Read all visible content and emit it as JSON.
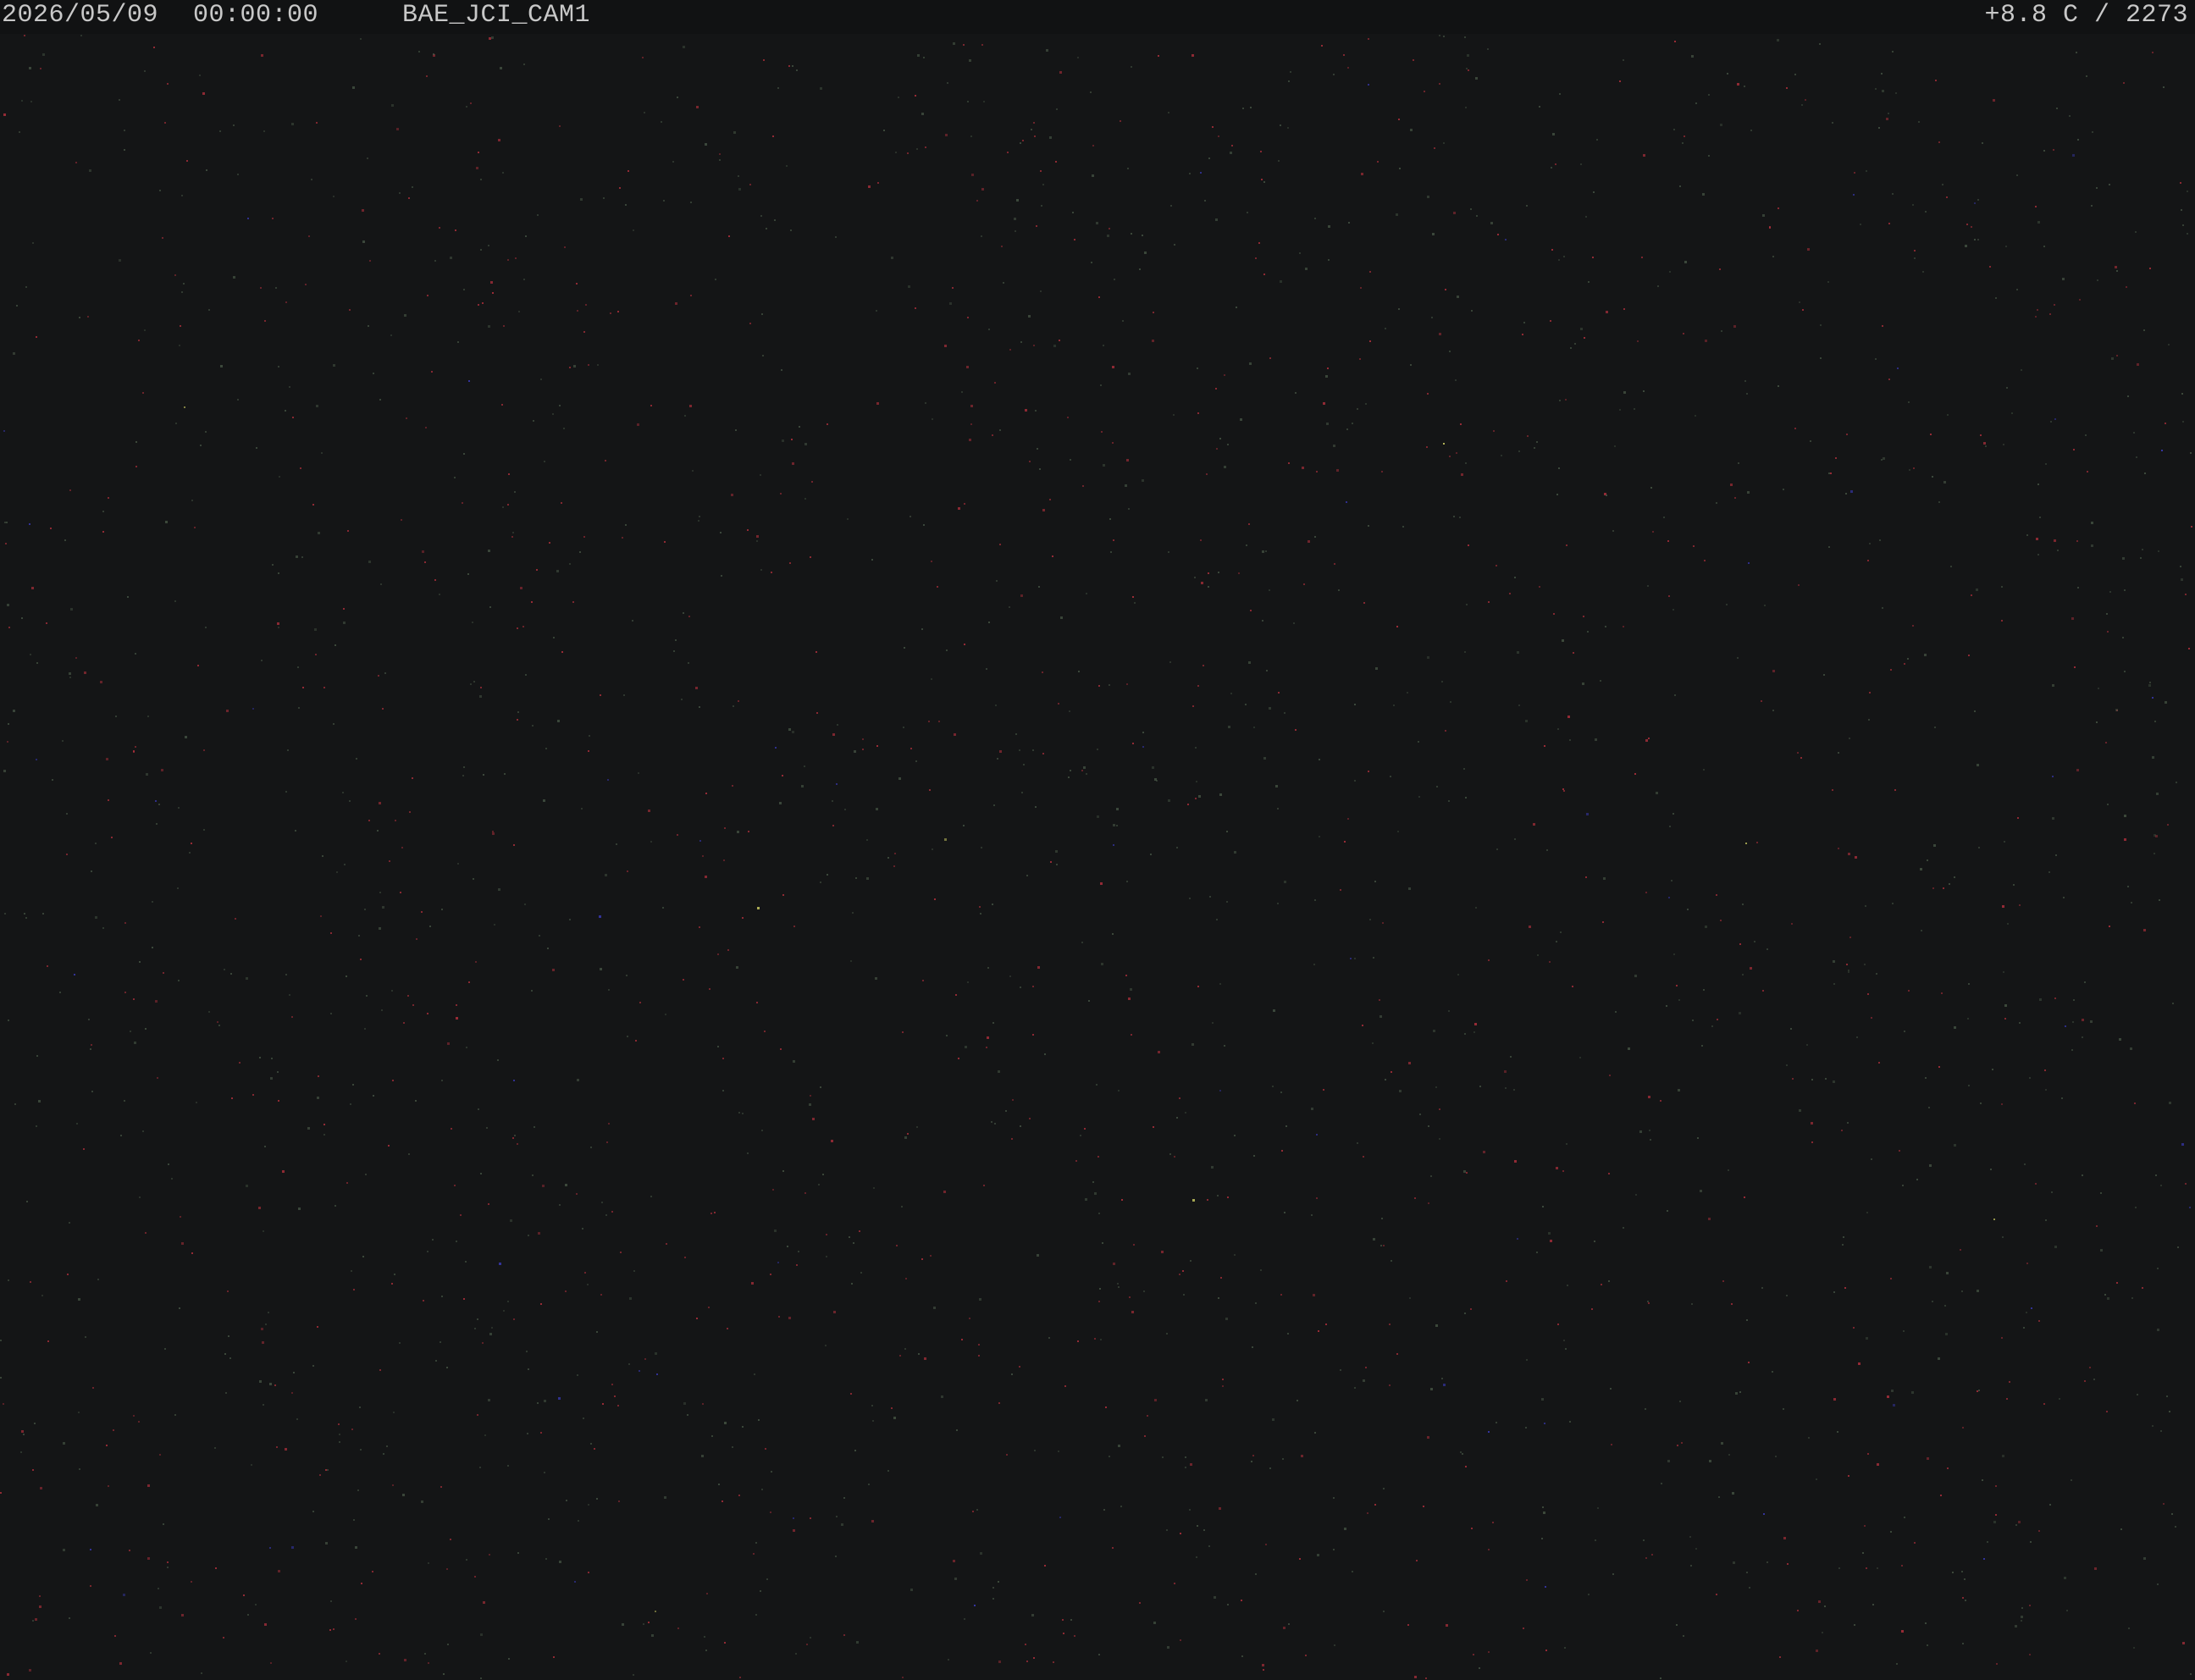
{
  "camera_feed": {
    "date": "2026/05/09",
    "time": "00:00:00",
    "camera_name": "BAE_JCI_CAM1",
    "sensor_readout": "+8.8 C / 2273"
  },
  "colors": {
    "background": "#141516",
    "overlay_text": "#c8c8c8",
    "noise_red": "#b0303c",
    "noise_green": "#4a5a48",
    "noise_blue": "#3838b0",
    "noise_yellow": "#c8c860"
  }
}
